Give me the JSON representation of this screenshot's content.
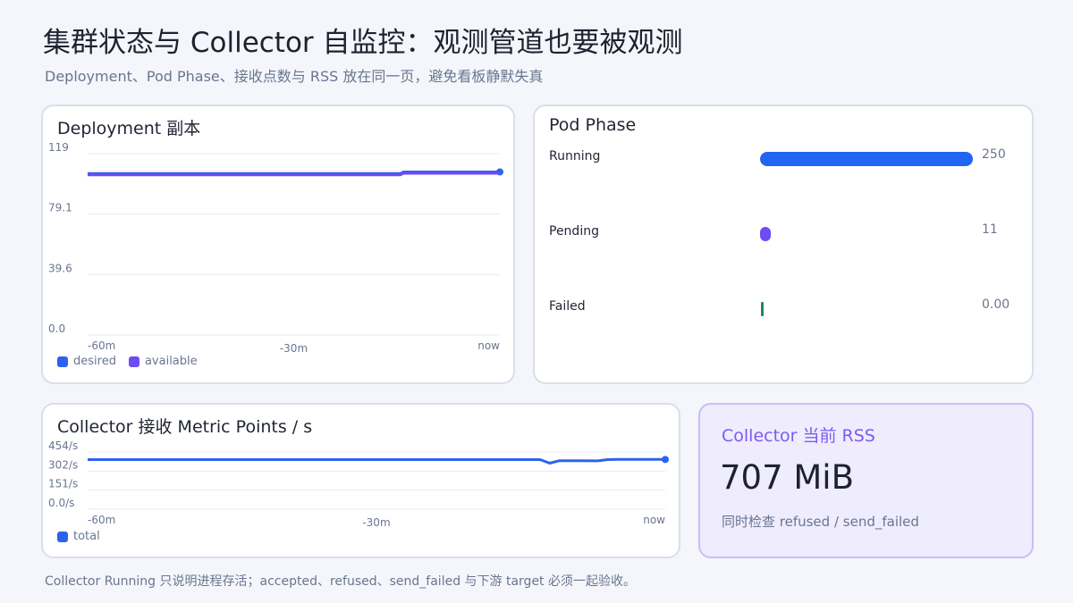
{
  "header": {
    "title": "集群状态与 Collector 自监控：观测管道也要被观测",
    "subtitle": "Deployment、Pod Phase、接收点数与 RSS 放在同一页，避免看板静默失真"
  },
  "colors": {
    "desired": "#2b63f0",
    "available": "#6d4cf2",
    "running": "#2166f3",
    "pending": "#6d4cf2",
    "failed": "#1e8a63",
    "total": "#2b63f0",
    "grid": "#e6eaf2"
  },
  "deployment_card": {
    "title": "Deployment 副本",
    "legend": [
      {
        "name": "desired",
        "color": "#2b63f0"
      },
      {
        "name": "available",
        "color": "#6d4cf2"
      }
    ]
  },
  "phase_card": {
    "title": "Pod Phase"
  },
  "metric_card": {
    "title": "Collector 接收 Metric Points / s",
    "legend": [
      {
        "name": "total",
        "color": "#2b63f0"
      }
    ]
  },
  "rss_card": {
    "title": "Collector 当前 RSS",
    "value": "707 MiB",
    "note": "同时检查 refused / send_failed"
  },
  "footer": {
    "note": "Collector Running 只说明进程存活；accepted、refused、send_failed 与下游 target 必须一起验收。"
  },
  "chart_data": [
    {
      "type": "line",
      "id": "deployment",
      "title": "Deployment 副本",
      "ylim": [
        0,
        119
      ],
      "y_tick_labels": [
        "119",
        "79.1",
        "39.6",
        "0.0"
      ],
      "x_tick_labels": [
        "-60m",
        "-30m",
        "now"
      ],
      "x": [
        -60,
        -45,
        -30,
        -15,
        -14.5,
        -14,
        0
      ],
      "series": [
        {
          "name": "desired",
          "values": [
            106,
            106,
            106,
            106,
            106,
            107,
            107
          ]
        },
        {
          "name": "available",
          "values": [
            106,
            106,
            106,
            106,
            106,
            107,
            107
          ]
        }
      ]
    },
    {
      "type": "bar",
      "id": "pod_phase",
      "title": "Pod Phase",
      "orientation": "horizontal",
      "categories": [
        "Running",
        "Pending",
        "Failed"
      ],
      "values": [
        250,
        11,
        0
      ],
      "value_labels": [
        "250",
        "11",
        "0.00"
      ]
    },
    {
      "type": "line",
      "id": "metric_points",
      "title": "Collector 接收 Metric Points / s",
      "ylim": [
        0,
        454
      ],
      "y_tick_labels": [
        "454/s",
        "302/s",
        "151/s",
        "0.0/s"
      ],
      "x_tick_labels": [
        "-60m",
        "-30m",
        "now"
      ],
      "x": [
        -60,
        -50,
        -40,
        -30,
        -20,
        -13,
        -12,
        -11,
        -9,
        -7,
        -6,
        -5,
        0
      ],
      "series": [
        {
          "name": "total",
          "values": [
            394,
            394,
            394,
            394,
            394,
            394,
            365,
            385,
            385,
            384,
            394,
            395,
            395
          ]
        }
      ]
    }
  ]
}
